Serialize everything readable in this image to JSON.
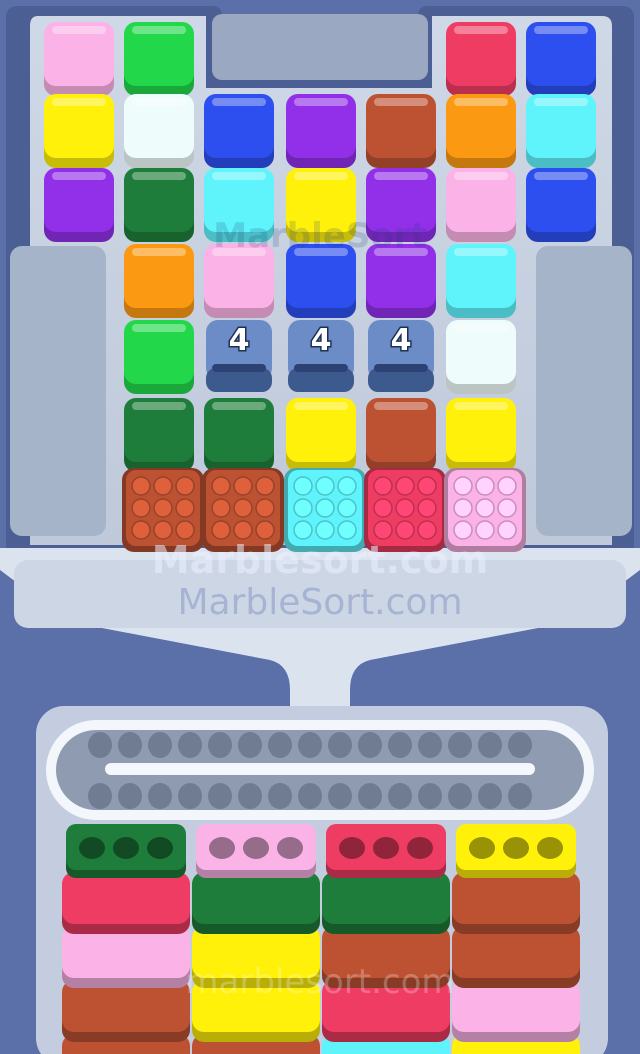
{
  "watermark": {
    "primary": "Marblesort.com",
    "secondary": "MarbleSort.com",
    "faint": "marblesort.com",
    "ghost": "MarbleSort"
  },
  "palette": {
    "pink": "#fbb2e6",
    "green": "#22d84a",
    "red": "#ee3c63",
    "blue": "#2d4ff0",
    "yellow": "#fff10a",
    "white": "#eefcfb",
    "purple": "#9130e8",
    "brown": "#bd5233",
    "orange": "#fb9a12",
    "cyan": "#5ff3fb",
    "dkgreen": "#1e7d3a"
  },
  "board": {
    "columns": 7,
    "rows": [
      [
        "pink",
        "green",
        null,
        null,
        null,
        "red",
        "blue"
      ],
      [
        "yellow",
        "white",
        "blue",
        "purple",
        "brown",
        "orange",
        "cyan"
      ],
      [
        "purple",
        "dkgreen",
        "cyan",
        "yellow",
        "purple",
        "pink",
        "blue"
      ],
      [
        null,
        "orange",
        "pink",
        "blue",
        "purple",
        "cyan",
        null
      ],
      [
        null,
        "green",
        "locked",
        "locked",
        "locked",
        "white",
        null
      ],
      [
        null,
        "dkgreen",
        "dkgreen",
        "yellow",
        "brown",
        "yellow",
        null
      ],
      [
        null,
        "brown-dots",
        "brown-dots",
        "cyan-dots",
        "red-dots",
        "pink-dots",
        null
      ]
    ],
    "locked_labels": [
      "4",
      "4",
      "4"
    ]
  },
  "conveyor": {
    "slots": 30,
    "state": "empty"
  },
  "bins": [
    {
      "lid": "dkgreen",
      "holes": 3,
      "stack": [
        "red",
        "pink",
        "brown",
        "brown"
      ]
    },
    {
      "lid": "pink",
      "holes": 3,
      "stack": [
        "dkgreen",
        "yellow",
        "yellow",
        "brown"
      ]
    },
    {
      "lid": "red",
      "holes": 3,
      "stack": [
        "dkgreen",
        "brown",
        "red",
        "cyan"
      ]
    },
    {
      "lid": "yellow",
      "holes": 3,
      "stack": [
        "brown",
        "brown",
        "pink",
        "yellow"
      ]
    }
  ]
}
